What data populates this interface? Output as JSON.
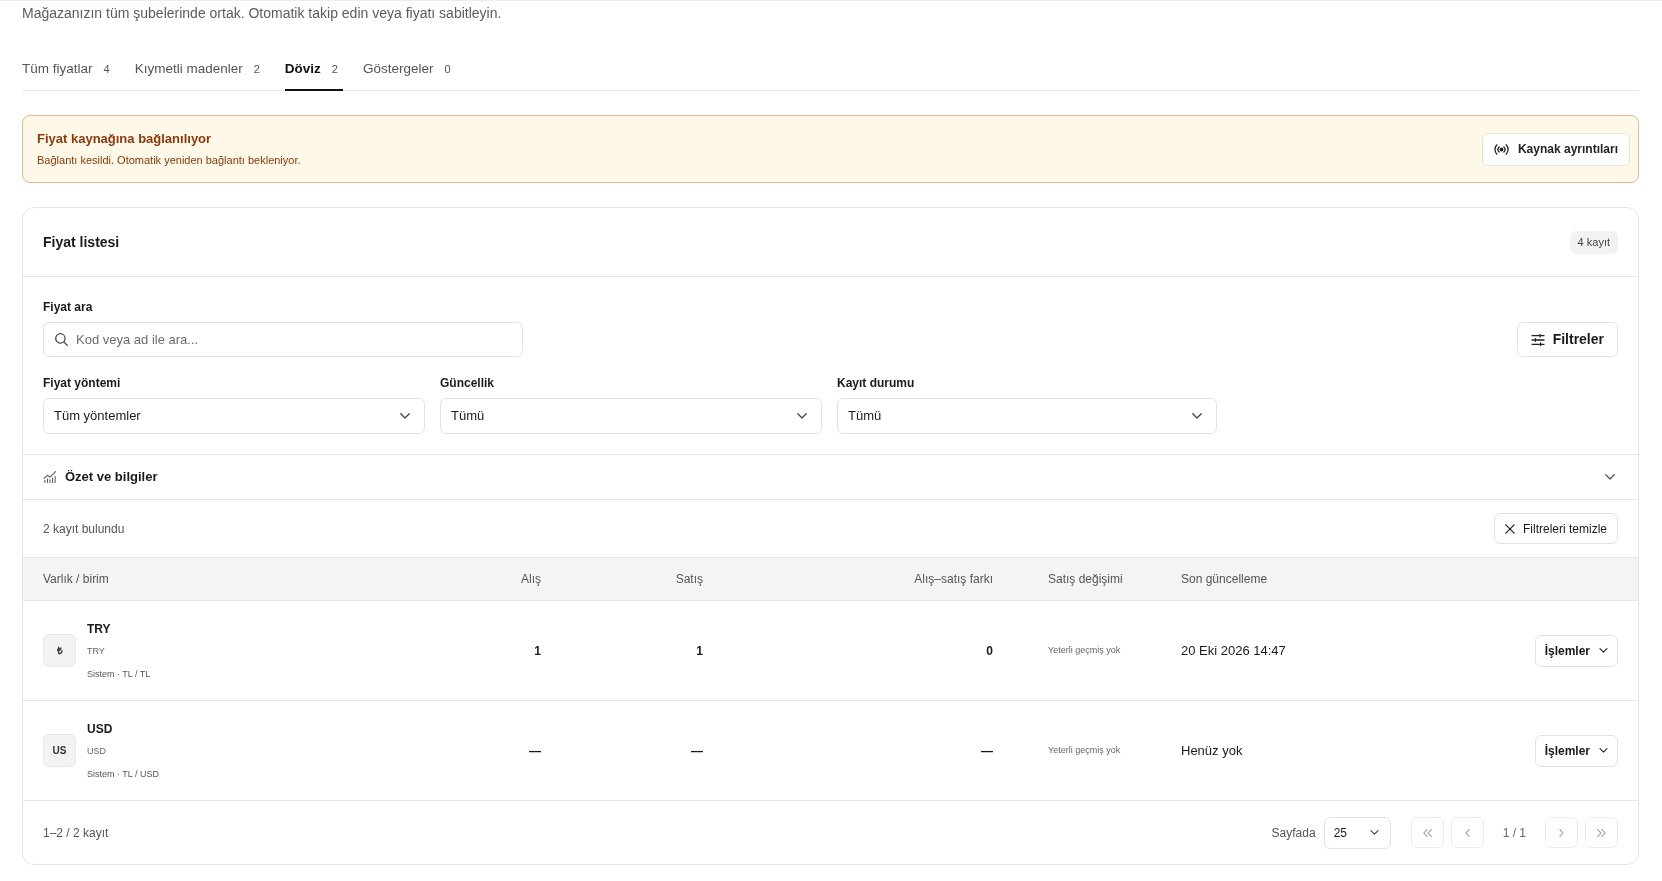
{
  "page": {
    "description": "Mağazanızın tüm şubelerinde ortak. Otomatik takip edin veya fiyatı sabitleyin."
  },
  "tabs": [
    {
      "label": "Tüm fiyatlar",
      "count": "4",
      "selected": false
    },
    {
      "label": "Kıymetli madenler",
      "count": "2",
      "selected": false
    },
    {
      "label": "Döviz",
      "count": "2",
      "selected": true
    },
    {
      "label": "Göstergeler",
      "count": "0",
      "selected": false
    }
  ],
  "alert": {
    "title": "Fiyat kaynağına bağlanılıyor",
    "message": "Bağlantı kesildi. Otomatik yeniden bağlantı bekleniyor.",
    "button": "Kaynak ayrıntıları"
  },
  "price_list": {
    "title": "Fiyat listesi",
    "badge": "4 kayıt",
    "search": {
      "label": "Fiyat ara",
      "placeholder": "Kod veya ad ile ara..."
    },
    "filters_button": "Filtreler",
    "selects": [
      {
        "label": "Fiyat yöntemi",
        "value": "Tüm yöntemler"
      },
      {
        "label": "Güncellik",
        "value": "Tümü"
      },
      {
        "label": "Kayıt durumu",
        "value": "Tümü"
      }
    ],
    "summary": {
      "label": "Özet ve bilgiler",
      "expanded": false
    },
    "result_count": "2 kayıt bulundu",
    "clear_button": "Filtreleri temizle",
    "table": {
      "columns": [
        "Varlık / birim",
        "Alış",
        "Satış",
        "Alış–satış farkı",
        "Satış değişimi",
        "Son güncelleme"
      ],
      "rows": [
        {
          "avatar": "₺",
          "code": "TRY",
          "name": "TRY",
          "source": "Sistem · TL / TL",
          "buy": "1",
          "sell": "1",
          "spread": "0",
          "change": "Yeterli geçmiş yok",
          "updated": "20 Eki 2026 14:47",
          "action": "İşlemler"
        },
        {
          "avatar": "US",
          "code": "USD",
          "name": "USD",
          "source": "Sistem · TL / USD",
          "buy": "—",
          "sell": "—",
          "spread": "—",
          "change": "Yeterli geçmiş yok",
          "updated": "Henüz yok",
          "action": "İşlemler"
        }
      ]
    },
    "pagination": {
      "range": "1–2 / 2 kayıt",
      "per_page_label": "Sayfada",
      "per_page": "25",
      "page": "1 / 1",
      "nav": [
        {
          "kind": "first",
          "disabled": true
        },
        {
          "kind": "prev",
          "disabled": true
        },
        {
          "kind": "next",
          "disabled": true
        },
        {
          "kind": "last",
          "disabled": true
        }
      ]
    }
  }
}
